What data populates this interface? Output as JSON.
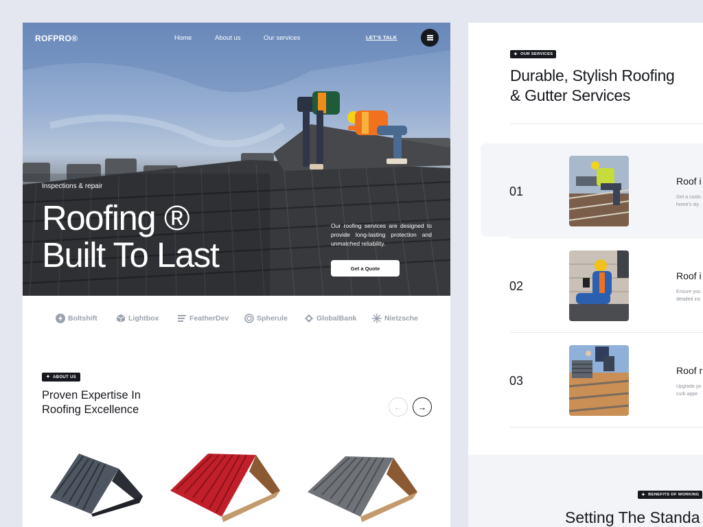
{
  "nav": {
    "logo": "ROFPRO®",
    "links": [
      "Home",
      "About us",
      "Our services"
    ],
    "cta": "LET'S TALK"
  },
  "hero": {
    "eyebrow": "Inspections & repair",
    "title_line1": "Roofing ®",
    "title_line2": "Built To Last",
    "description": "Our roofing services are designed to provide long-lasting protection and unmatched reliability.",
    "button": "Get a Quote"
  },
  "brands": [
    "Boltshift",
    "Lightbox",
    "FeatherDev",
    "Spherule",
    "GlobalBank",
    "Nietzsche"
  ],
  "about": {
    "badge": "ABOUT US",
    "title_line1": "Proven Expertise In",
    "title_line2": "Roofing Excellence",
    "products": [
      {
        "name": "dark-gray-roof-sample",
        "color": "#4d5661"
      },
      {
        "name": "red-roof-sample",
        "color": "#c1202a"
      },
      {
        "name": "gray-roof-sample",
        "color": "#6f7276"
      }
    ]
  },
  "services": {
    "badge": "OUR SERVICES",
    "title_line1": "Durable, Stylish Roofing",
    "title_line2": "& Gutter Services",
    "items": [
      {
        "number": "01",
        "name": "Roof i",
        "desc_line1": "Get a custo",
        "desc_line2": "home's sty"
      },
      {
        "number": "02",
        "name": "Roof i",
        "desc_line1": "Ensure you",
        "desc_line2": "detailed ins"
      },
      {
        "number": "03",
        "name": "Roof r",
        "desc_line1": "Upgrade yo",
        "desc_line2": "curb appe"
      }
    ]
  },
  "benefits": {
    "badge": "BENEFITS OF WORKING",
    "title": "Setting The Standa"
  },
  "colors": {
    "background": "#e4e7ef",
    "dark": "#16181d",
    "muted": "#9aa1ad"
  }
}
